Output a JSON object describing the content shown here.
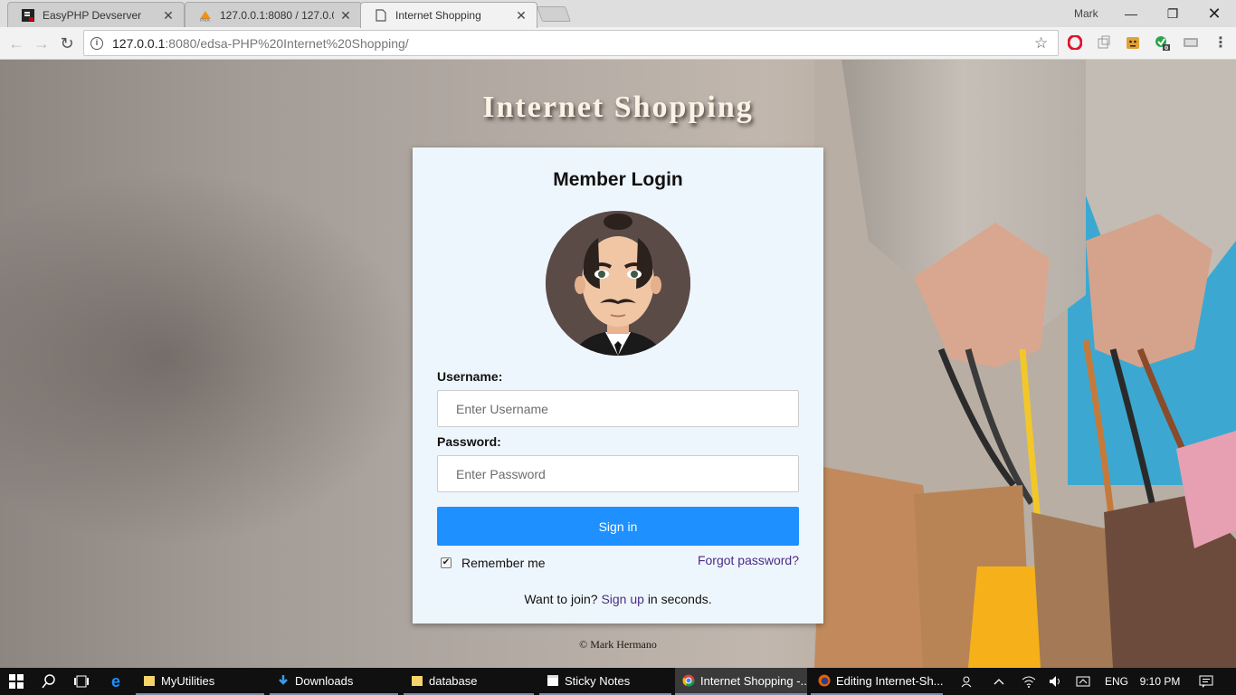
{
  "browser": {
    "tabs": [
      {
        "title": "EasyPHP Devserver",
        "icon": "easyphp-icon",
        "active": false
      },
      {
        "title": "127.0.0.1:8080 / 127.0.0.1",
        "icon": "phpmyadmin-icon",
        "active": false
      },
      {
        "title": "Internet Shopping",
        "icon": "page-icon",
        "active": true
      }
    ],
    "user": "Mark",
    "url_host": "127.0.0.1",
    "url_path": ":8080/edsa-PHP%20Internet%20Shopping/",
    "extensions": [
      "opera-icon",
      "extension-icon",
      "extension-face-icon",
      "extension-green-icon",
      "extension-gray-icon"
    ],
    "extension_badge": "0"
  },
  "page": {
    "title": "Internet Shopping",
    "login": {
      "heading": "Member Login",
      "username_label": "Username:",
      "username_placeholder": "Enter Username",
      "password_label": "Password:",
      "password_placeholder": "Enter Password",
      "signin_label": "Sign in",
      "remember_label": "Remember me",
      "remember_checked": true,
      "forgot_label": "Forgot password?",
      "join_prefix": "Want to join?",
      "join_link": "Sign up",
      "join_suffix": "in seconds."
    },
    "footer": "© Mark Hermano",
    "colors": {
      "primary_button": "#1e90ff",
      "link": "#4b2b86",
      "card_bg": "#eef6fd"
    }
  },
  "taskbar": {
    "apps": [
      {
        "label": "MyUtilities",
        "icon": "folder-icon"
      },
      {
        "label": "Downloads",
        "icon": "download-icon"
      },
      {
        "label": "database",
        "icon": "folder-icon"
      },
      {
        "label": "Sticky Notes",
        "icon": "sticky-notes-icon"
      },
      {
        "label": "Internet Shopping -...",
        "icon": "chrome-icon",
        "active": true
      },
      {
        "label": "Editing Internet-Sh...",
        "icon": "firefox-icon"
      }
    ],
    "language": "ENG",
    "time": "9:10 PM"
  }
}
